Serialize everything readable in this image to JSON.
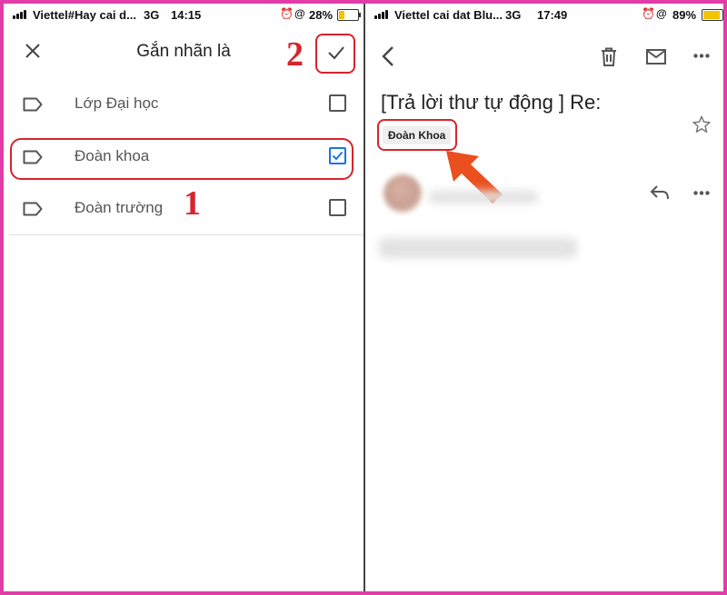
{
  "left": {
    "status": {
      "carrier": "Viettel#Hay cai d...",
      "network": "3G",
      "time": "14:15",
      "battery": "28%",
      "battery_level": 0.28
    },
    "title": "Gắn nhãn là",
    "step_done": "2",
    "step_select": "1",
    "labels": [
      {
        "name": "Lớp Đại học",
        "checked": false
      },
      {
        "name": "Đoàn khoa",
        "checked": true
      },
      {
        "name": "Đoàn trường",
        "checked": false
      }
    ]
  },
  "right": {
    "status": {
      "carrier": "Viettel cai dat Blu...",
      "network": "3G",
      "time": "17:49",
      "battery": "89%",
      "battery_level": 0.89
    },
    "subject": "[Trả lời thư tự động ] Re:",
    "label_chip": "Đoàn Khoa"
  },
  "colors": {
    "frame": "#e23ca8",
    "annotation": "#d8232a",
    "arrow": "#ea4f1f",
    "checkbox": "#1a73e8"
  },
  "icons": [
    "close-icon",
    "check-icon",
    "tag-icon",
    "checkbox-icon",
    "back-icon",
    "trash-icon",
    "mail-icon",
    "more-icon",
    "star-icon",
    "reply-icon",
    "arrow-icon"
  ]
}
